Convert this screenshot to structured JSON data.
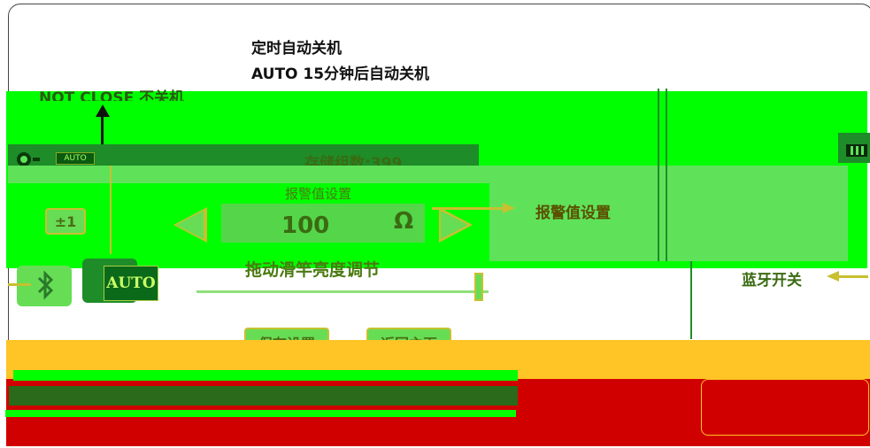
{
  "annotations": {
    "auto_off_title": "定时自动关机",
    "auto_off_auto": "AUTO 15分钟后自动关机",
    "auto_off_not_close": "NOT CLOSE 不关机",
    "auto_off_not_close_partial": "NOT CLOSE 不",
    "alarm_setting_label": "报警值设置",
    "bluetooth_switch_label": "蓝牙开关"
  },
  "device_screen": {
    "header": {
      "stored_groups": "存储组数:399",
      "auto_badge": "AUTO"
    },
    "alarm": {
      "title": "报警值设置",
      "step": "±1",
      "value": "100",
      "unit": "Ω"
    },
    "bluetooth": {
      "auto_button": "AUTO"
    },
    "brightness": {
      "label": "拖动滑竿亮度调节",
      "level_fraction": 0.97
    },
    "buttons": {
      "save": "保存设置",
      "back": "返回主页"
    }
  },
  "colors": {
    "screen_green": "#00ff00",
    "header_dark_green": "#1e8c28",
    "panel_light_green": "#5fe25a",
    "footer_red": "#d10000",
    "footer_orange": "#ffc425",
    "arrow_olive": "#c8c030"
  }
}
